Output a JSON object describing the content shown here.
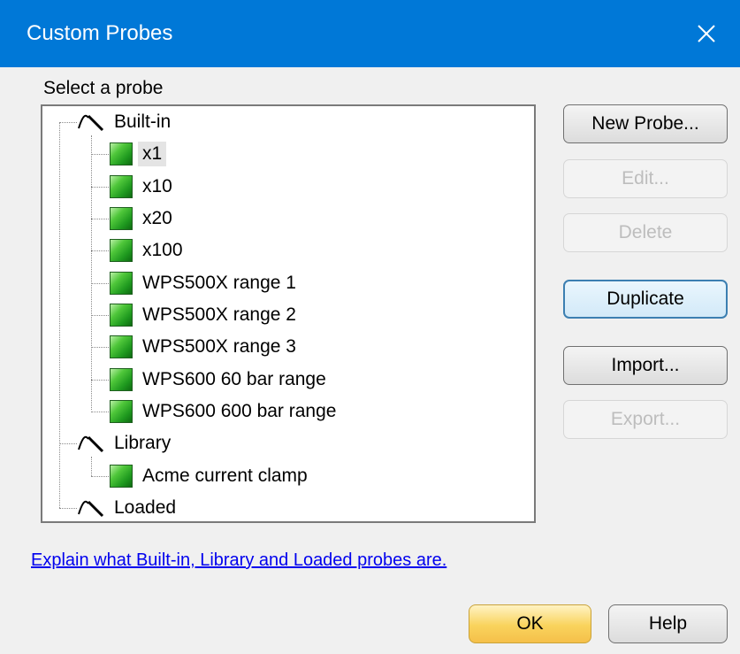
{
  "window": {
    "title": "Custom Probes",
    "close_glyph": "✕"
  },
  "tree": {
    "label": "Select a probe",
    "groups": [
      {
        "name": "Built-in",
        "items": [
          "x1",
          "x10",
          "x20",
          "x100",
          "WPS500X range 1",
          "WPS500X range 2",
          "WPS500X range 3",
          "WPS600 60 bar range",
          "WPS600 600 bar range"
        ]
      },
      {
        "name": "Library",
        "items": [
          "Acme current clamp"
        ]
      },
      {
        "name": "Loaded",
        "items": []
      }
    ],
    "selected": "x1"
  },
  "buttons": {
    "new_probe": "New Probe...",
    "edit": "Edit...",
    "delete": "Delete",
    "duplicate": "Duplicate",
    "import": "Import...",
    "export": "Export..."
  },
  "help_link": "Explain what Built-in, Library and Loaded probes are.",
  "footer": {
    "ok": "OK",
    "help": "Help"
  },
  "colors": {
    "titlebar": "#0078d7",
    "probe_icon_green": "#2fae2a",
    "link": "#0000ee"
  }
}
